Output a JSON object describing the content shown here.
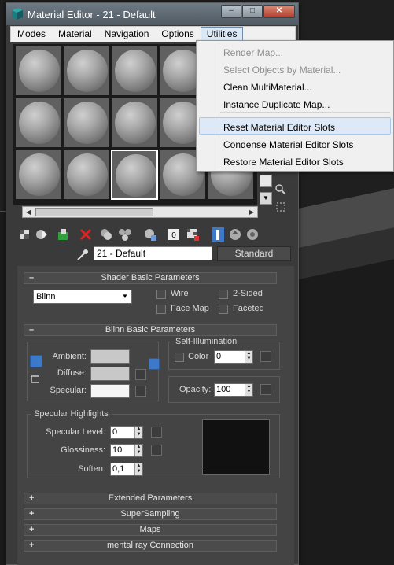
{
  "window": {
    "title": "Material Editor - 21 - Default",
    "buttons": {
      "minimize": "–",
      "maximize": "□",
      "close": "✕"
    }
  },
  "menubar": {
    "items": [
      "Modes",
      "Material",
      "Navigation",
      "Options",
      "Utilities"
    ],
    "active": "Utilities"
  },
  "utilities_menu": {
    "items": [
      {
        "label": "Render Map...",
        "enabled": false
      },
      {
        "label": "Select Objects by Material...",
        "enabled": false
      },
      {
        "label": "Clean MultiMaterial...",
        "enabled": true
      },
      {
        "label": "Instance Duplicate Map...",
        "enabled": true
      },
      {
        "label": "Reset Material Editor Slots",
        "enabled": true,
        "highlighted": true
      },
      {
        "label": "Condense Material Editor Slots",
        "enabled": true
      },
      {
        "label": "Restore Material Editor Slots",
        "enabled": true
      }
    ]
  },
  "material": {
    "name": "21 - Default",
    "type_button": "Standard"
  },
  "shader_basic": {
    "header": "Shader Basic Parameters",
    "sign": "–",
    "shader": "Blinn",
    "options": [
      "Wire",
      "2-Sided",
      "Face Map",
      "Faceted"
    ]
  },
  "blinn_basic": {
    "header": "Blinn Basic Parameters",
    "sign": "–",
    "ambient_label": "Ambient:",
    "diffuse_label": "Diffuse:",
    "specular_label": "Specular:",
    "self_illum_title": "Self-Illumination",
    "color_label": "Color",
    "color_value": "0",
    "opacity_label": "Opacity:",
    "opacity_value": "100",
    "ambient_color": "#c8c8c8",
    "diffuse_color": "#c8c8c8",
    "specular_color": "#f5f5f5"
  },
  "specular_highlights": {
    "title": "Specular Highlights",
    "level_label": "Specular Level:",
    "level_value": "0",
    "gloss_label": "Glossiness:",
    "gloss_value": "10",
    "soften_label": "Soften:",
    "soften_value": "0,1"
  },
  "collapsed_rollouts": [
    {
      "sign": "+",
      "label": "Extended Parameters"
    },
    {
      "sign": "+",
      "label": "SuperSampling"
    },
    {
      "sign": "+",
      "label": "Maps"
    },
    {
      "sign": "+",
      "label": "mental ray Connection"
    }
  ],
  "colors": {
    "menu_highlight": "#dde9f7",
    "accent_blue": "#3d79c9"
  }
}
